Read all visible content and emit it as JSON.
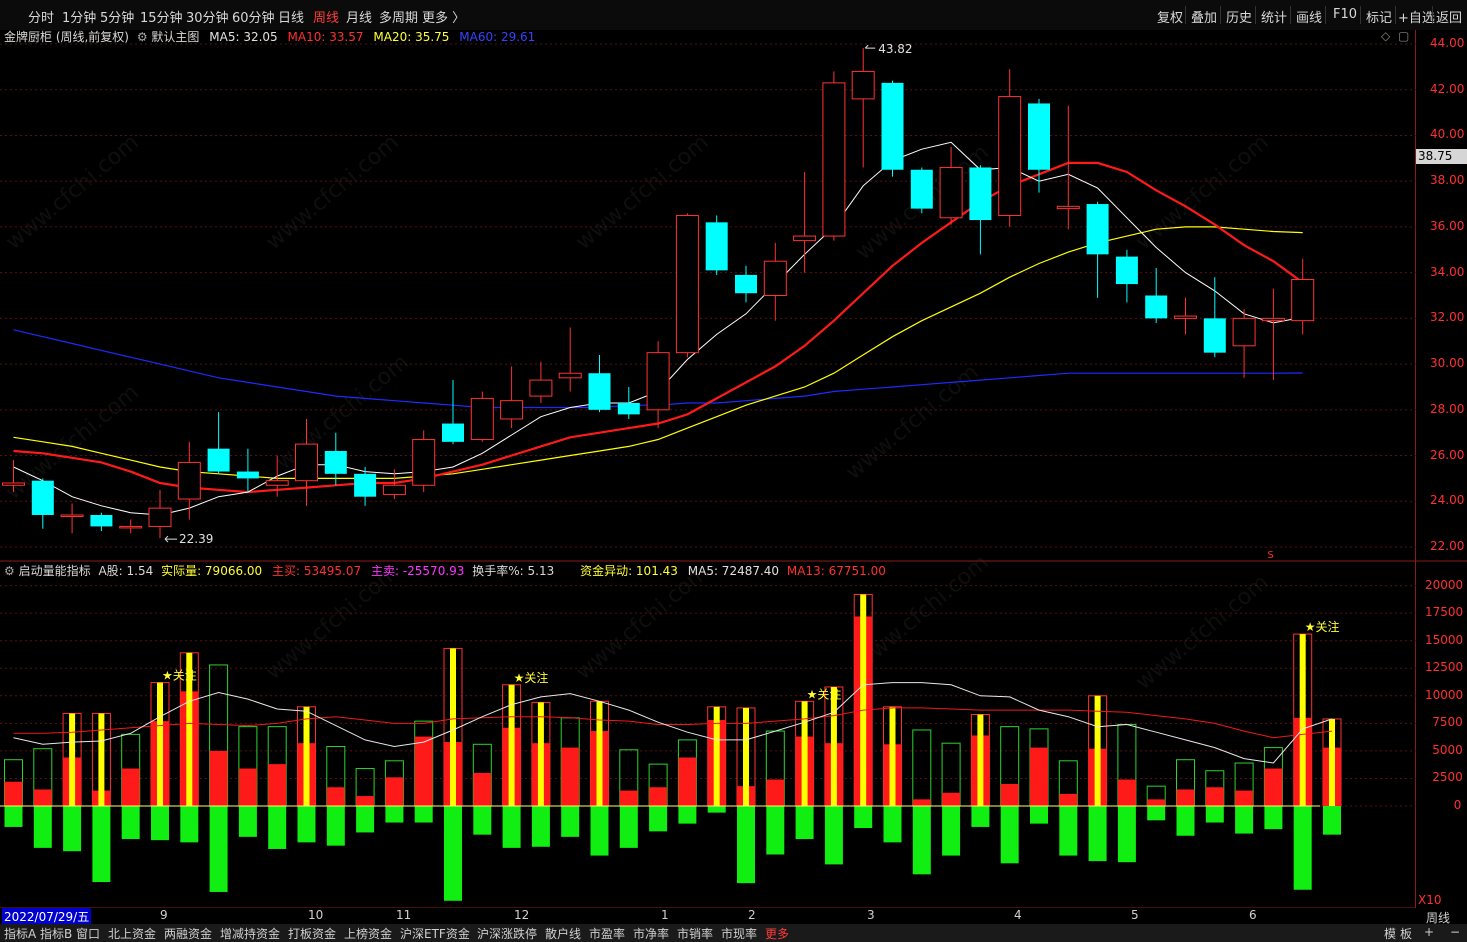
{
  "toolbar": {
    "timeframes": [
      "分时",
      "1分钟",
      "5分钟",
      "15分钟",
      "30分钟",
      "60分钟",
      "日线",
      "周线",
      "月线",
      "多周期",
      "更多 〉"
    ],
    "active_timeframe": "周线",
    "tools": [
      "复权",
      "叠加",
      "历史",
      "统计",
      "画线",
      "F10",
      "标记",
      "+自选",
      "返回"
    ]
  },
  "main_chart": {
    "stock_title": "金牌厨柜 (周线,前复权)",
    "template_label": "默认主图",
    "ma5": "MA5: 32.05",
    "ma10": "MA10: 33.57",
    "ma20": "MA20: 35.75",
    "ma60": "MA60: 29.61",
    "high_label": "43.82",
    "low_label": "22.39",
    "current_price": "38.75",
    "price_ticks": [
      "44.00",
      "42.00",
      "40.00",
      "38.00",
      "36.00",
      "34.00",
      "32.00",
      "30.00",
      "28.00",
      "26.00",
      "24.00",
      "22.00"
    ],
    "colors": {
      "up": "#ff3232",
      "down": "#00ffff",
      "ma5": "#ffffff",
      "ma10": "#ff1a1a",
      "ma20": "#ffff00",
      "ma60": "#1e2bff"
    }
  },
  "sub_chart": {
    "indicator": "启动量能指标",
    "a_share": "A股: 1.54",
    "actual_vol": "实际量: 79066.00",
    "main_buy": "主买: 53495.07",
    "main_sell": "主卖: -25570.93",
    "turnover": "换手率%: 5.13",
    "capital_anomaly": "资金异动: 101.43",
    "ma5": "MA5: 72487.40",
    "ma13": "MA13: 67751.00",
    "vol_ticks": [
      "20000",
      "17500",
      "15000",
      "12500",
      "10000",
      "7500",
      "5000",
      "2500",
      "0"
    ],
    "unit": "X10",
    "attention_label": "★关注"
  },
  "date_axis": {
    "start_date": "2022/07/29/五",
    "months": [
      "9",
      "10",
      "11",
      "12",
      "1",
      "2",
      "3",
      "4",
      "5",
      "6"
    ],
    "period": "周线"
  },
  "bottom_tabs": [
    "指标A",
    "指标B",
    "窗口",
    "北上资金",
    "两融资金",
    "增减持资金",
    "打板资金",
    "上榜资金",
    "沪深ETF资金",
    "沪深涨跌停",
    "散户线",
    "市盈率",
    "市净率",
    "市销率",
    "市现率",
    "更多"
  ],
  "bottom_right": [
    "模",
    "板",
    "+",
    "−"
  ],
  "watermark": "www.cfchi.com",
  "chart_data": {
    "type": "candlestick",
    "candles": [
      {
        "o": 24.7,
        "c": 24.8,
        "h": 25.8,
        "l": 24.4
      },
      {
        "o": 24.9,
        "c": 23.4,
        "h": 25.0,
        "l": 22.8
      },
      {
        "o": 23.4,
        "c": 23.4,
        "h": 23.9,
        "l": 22.6
      },
      {
        "o": 23.4,
        "c": 22.9,
        "h": 23.5,
        "l": 22.7
      },
      {
        "o": 22.9,
        "c": 22.9,
        "h": 23.2,
        "l": 22.6
      },
      {
        "o": 22.9,
        "c": 23.7,
        "h": 24.5,
        "l": 22.39
      },
      {
        "o": 24.1,
        "c": 25.7,
        "h": 26.6,
        "l": 23.2
      },
      {
        "o": 26.3,
        "c": 25.3,
        "h": 27.9,
        "l": 25.2
      },
      {
        "o": 25.3,
        "c": 25.0,
        "h": 26.3,
        "l": 24.4
      },
      {
        "o": 24.7,
        "c": 24.9,
        "h": 26.0,
        "l": 24.2
      },
      {
        "o": 24.9,
        "c": 26.5,
        "h": 27.6,
        "l": 23.8
      },
      {
        "o": 26.2,
        "c": 25.2,
        "h": 27.0,
        "l": 24.7
      },
      {
        "o": 25.2,
        "c": 24.2,
        "h": 25.5,
        "l": 23.8
      },
      {
        "o": 24.3,
        "c": 24.7,
        "h": 25.4,
        "l": 24.1
      },
      {
        "o": 24.7,
        "c": 26.7,
        "h": 27.1,
        "l": 24.4
      },
      {
        "o": 27.4,
        "c": 26.6,
        "h": 29.3,
        "l": 26.5
      },
      {
        "o": 26.7,
        "c": 28.5,
        "h": 28.8,
        "l": 26.6
      },
      {
        "o": 27.6,
        "c": 28.4,
        "h": 29.9,
        "l": 27.2
      },
      {
        "o": 28.6,
        "c": 29.3,
        "h": 30.1,
        "l": 28.3
      },
      {
        "o": 29.4,
        "c": 29.6,
        "h": 31.6,
        "l": 28.8
      },
      {
        "o": 29.6,
        "c": 28.0,
        "h": 30.4,
        "l": 27.9
      },
      {
        "o": 28.3,
        "c": 27.8,
        "h": 29.0,
        "l": 27.6
      },
      {
        "o": 28.0,
        "c": 30.5,
        "h": 31.0,
        "l": 27.2
      },
      {
        "o": 30.5,
        "c": 36.5,
        "h": 36.6,
        "l": 30.3
      },
      {
        "o": 36.2,
        "c": 34.1,
        "h": 36.5,
        "l": 33.9
      },
      {
        "o": 33.9,
        "c": 33.1,
        "h": 34.3,
        "l": 32.7
      },
      {
        "o": 33.0,
        "c": 34.5,
        "h": 35.3,
        "l": 31.9
      },
      {
        "o": 35.4,
        "c": 35.6,
        "h": 38.4,
        "l": 34.0
      },
      {
        "o": 35.6,
        "c": 42.3,
        "h": 42.8,
        "l": 35.4
      },
      {
        "o": 41.6,
        "c": 42.8,
        "h": 43.82,
        "l": 38.6
      },
      {
        "o": 42.3,
        "c": 38.5,
        "h": 42.4,
        "l": 38.2
      },
      {
        "o": 38.5,
        "c": 36.8,
        "h": 38.6,
        "l": 36.6
      },
      {
        "o": 36.4,
        "c": 38.6,
        "h": 39.5,
        "l": 36.1
      },
      {
        "o": 38.6,
        "c": 36.3,
        "h": 38.7,
        "l": 34.8
      },
      {
        "o": 36.5,
        "c": 41.7,
        "h": 42.9,
        "l": 36.0
      },
      {
        "o": 41.4,
        "c": 38.5,
        "h": 41.6,
        "l": 37.5
      },
      {
        "o": 36.8,
        "c": 36.9,
        "h": 41.3,
        "l": 35.9
      },
      {
        "o": 37.0,
        "c": 34.8,
        "h": 37.1,
        "l": 32.9
      },
      {
        "o": 34.7,
        "c": 33.5,
        "h": 35.0,
        "l": 32.7
      },
      {
        "o": 33.0,
        "c": 32.0,
        "h": 34.2,
        "l": 31.8
      },
      {
        "o": 32.0,
        "c": 32.1,
        "h": 32.9,
        "l": 31.3
      },
      {
        "o": 32.0,
        "c": 30.5,
        "h": 33.8,
        "l": 30.3
      },
      {
        "o": 30.8,
        "c": 32.0,
        "h": 32.4,
        "l": 29.4
      },
      {
        "o": 31.9,
        "c": 32.0,
        "h": 33.3,
        "l": 29.3
      },
      {
        "o": 31.9,
        "c": 33.7,
        "h": 34.6,
        "l": 31.3
      }
    ],
    "ma5": [
      25.5,
      24.9,
      24.2,
      23.8,
      23.5,
      23.4,
      23.7,
      24.2,
      24.4,
      25.1,
      25.6,
      25.6,
      25.3,
      25.2,
      25.3,
      25.5,
      26.1,
      26.9,
      27.7,
      28.1,
      28.3,
      28.3,
      28.8,
      30.2,
      31.3,
      32.2,
      33.5,
      34.8,
      36.0,
      37.8,
      38.9,
      39.4,
      39.7,
      38.5,
      38.6,
      38.0,
      38.3,
      37.7,
      36.4,
      35.1,
      34.0,
      33.2,
      32.2,
      31.8,
      32.05
    ],
    "ma10": [
      26.2,
      26.1,
      25.9,
      25.7,
      25.3,
      24.8,
      24.6,
      24.5,
      24.4,
      24.5,
      24.6,
      24.7,
      24.8,
      24.8,
      25.0,
      25.3,
      25.6,
      26.0,
      26.4,
      26.8,
      27.0,
      27.2,
      27.4,
      27.8,
      28.5,
      29.2,
      29.9,
      30.8,
      31.9,
      33.1,
      34.3,
      35.3,
      36.2,
      37.1,
      37.8,
      38.3,
      38.8,
      38.8,
      38.4,
      37.6,
      36.9,
      36.1,
      35.2,
      34.5,
      33.57
    ],
    "ma20": [
      26.8,
      26.6,
      26.4,
      26.1,
      25.8,
      25.5,
      25.3,
      25.2,
      25.1,
      25.0,
      25.0,
      25.0,
      25.0,
      25.0,
      25.1,
      25.2,
      25.4,
      25.6,
      25.8,
      26.0,
      26.2,
      26.4,
      26.7,
      27.2,
      27.7,
      28.2,
      28.6,
      29.0,
      29.6,
      30.4,
      31.2,
      31.9,
      32.5,
      33.1,
      33.8,
      34.4,
      34.9,
      35.3,
      35.6,
      35.9,
      36.0,
      36.0,
      35.9,
      35.8,
      35.75
    ],
    "ma60": [
      31.5,
      31.2,
      30.9,
      30.6,
      30.3,
      30.0,
      29.7,
      29.4,
      29.2,
      29.0,
      28.8,
      28.6,
      28.5,
      28.4,
      28.3,
      28.2,
      28.1,
      28.1,
      28.1,
      28.1,
      28.1,
      28.2,
      28.2,
      28.3,
      28.3,
      28.4,
      28.5,
      28.6,
      28.8,
      28.9,
      29.0,
      29.1,
      29.2,
      29.3,
      29.4,
      29.5,
      29.6,
      29.6,
      29.6,
      29.6,
      29.6,
      29.6,
      29.6,
      29.6,
      29.61
    ],
    "volume": [
      {
        "t": 4200,
        "up": 2200,
        "dn": -1900,
        "y": false
      },
      {
        "t": 5200,
        "up": 1500,
        "dn": -3800,
        "y": false
      },
      {
        "t": 8400,
        "up": 4400,
        "dn": -4100,
        "y": true
      },
      {
        "t": 8400,
        "up": 1400,
        "dn": -6900,
        "y": true
      },
      {
        "t": 6500,
        "up": 3400,
        "dn": -3000,
        "y": false
      },
      {
        "t": 11200,
        "up": 7700,
        "dn": -3100,
        "y": true
      },
      {
        "t": 13900,
        "up": 10400,
        "dn": -3300,
        "y": true
      },
      {
        "t": 12800,
        "up": 5000,
        "dn": -7800,
        "y": false
      },
      {
        "t": 7200,
        "up": 3400,
        "dn": -2800,
        "y": false
      },
      {
        "t": 7200,
        "up": 3800,
        "dn": -3900,
        "y": false
      },
      {
        "t": 9000,
        "up": 5700,
        "dn": -3300,
        "y": true
      },
      {
        "t": 5400,
        "up": 1700,
        "dn": -3600,
        "y": false
      },
      {
        "t": 3400,
        "up": 900,
        "dn": -2400,
        "y": false
      },
      {
        "t": 4100,
        "up": 2600,
        "dn": -1500,
        "y": false
      },
      {
        "t": 7700,
        "up": 6300,
        "dn": -1500,
        "y": false
      },
      {
        "t": 14300,
        "up": 5800,
        "dn": -8600,
        "y": true
      },
      {
        "t": 5600,
        "up": 3000,
        "dn": -2600,
        "y": false
      },
      {
        "t": 11000,
        "up": 7100,
        "dn": -3800,
        "y": true
      },
      {
        "t": 9400,
        "up": 5700,
        "dn": -3700,
        "y": true
      },
      {
        "t": 8000,
        "up": 5300,
        "dn": -2800,
        "y": false
      },
      {
        "t": 9500,
        "up": 6800,
        "dn": -4500,
        "y": true
      },
      {
        "t": 5100,
        "up": 1400,
        "dn": -3800,
        "y": false
      },
      {
        "t": 3800,
        "up": 1700,
        "dn": -2300,
        "y": false
      },
      {
        "t": 6000,
        "up": 4400,
        "dn": -1600,
        "y": false
      },
      {
        "t": 9000,
        "up": 7800,
        "dn": -600,
        "y": true
      },
      {
        "t": 8900,
        "up": 1800,
        "dn": -7000,
        "y": true
      },
      {
        "t": 6800,
        "up": 2400,
        "dn": -4400,
        "y": false
      },
      {
        "t": 9500,
        "up": 6300,
        "dn": -3000,
        "y": true
      },
      {
        "t": 10800,
        "up": 5700,
        "dn": -5300,
        "y": true
      },
      {
        "t": 19200,
        "up": 17200,
        "dn": -2000,
        "y": true
      },
      {
        "t": 9000,
        "up": 5600,
        "dn": -3300,
        "y": true
      },
      {
        "t": 6900,
        "up": 600,
        "dn": -6200,
        "y": false
      },
      {
        "t": 5700,
        "up": 1200,
        "dn": -4500,
        "y": false
      },
      {
        "t": 8300,
        "up": 6400,
        "dn": -1900,
        "y": true
      },
      {
        "t": 7200,
        "up": 2000,
        "dn": -5200,
        "y": false
      },
      {
        "t": 7000,
        "up": 5300,
        "dn": -1600,
        "y": false
      },
      {
        "t": 4100,
        "up": 1100,
        "dn": -4500,
        "y": false
      },
      {
        "t": 10000,
        "up": 5200,
        "dn": -5000,
        "y": true
      },
      {
        "t": 7400,
        "up": 2400,
        "dn": -5100,
        "y": false
      },
      {
        "t": 1800,
        "up": 600,
        "dn": -1300,
        "y": false
      },
      {
        "t": 4200,
        "up": 1500,
        "dn": -2700,
        "y": false
      },
      {
        "t": 3200,
        "up": 1700,
        "dn": -1500,
        "y": false
      },
      {
        "t": 3900,
        "up": 1400,
        "dn": -2500,
        "y": false
      },
      {
        "t": 5300,
        "up": 3400,
        "dn": -2100,
        "y": false
      },
      {
        "t": 15600,
        "up": 8000,
        "dn": -7600,
        "y": true
      },
      {
        "t": 7900,
        "up": 5300,
        "dn": -2600,
        "y": true
      }
    ],
    "vol_ma5": [
      6200,
      5600,
      5800,
      5900,
      6600,
      8100,
      9500,
      10300,
      9700,
      8800,
      8600,
      7300,
      6000,
      5400,
      5800,
      6900,
      8100,
      9200,
      9900,
      10200,
      9500,
      8700,
      7600,
      6700,
      6000,
      6000,
      6800,
      7600,
      8500,
      11000,
      11200,
      11200,
      11000,
      10000,
      9900,
      8700,
      8100,
      7200,
      7400,
      6700,
      6000,
      5300,
      4300,
      3900,
      7000,
      7900
    ],
    "vol_ma13": [
      6600,
      6600,
      6700,
      6900,
      7100,
      7300,
      7500,
      7400,
      7300,
      7500,
      7900,
      8100,
      7800,
      7500,
      7500,
      7900,
      8000,
      8100,
      8100,
      8000,
      7800,
      7700,
      7400,
      7400,
      7500,
      7500,
      7700,
      7900,
      8200,
      8700,
      8900,
      8900,
      8800,
      8700,
      8700,
      8700,
      8700,
      8600,
      8500,
      8200,
      7900,
      7500,
      6800,
      6200,
      6500,
      6800
    ]
  }
}
